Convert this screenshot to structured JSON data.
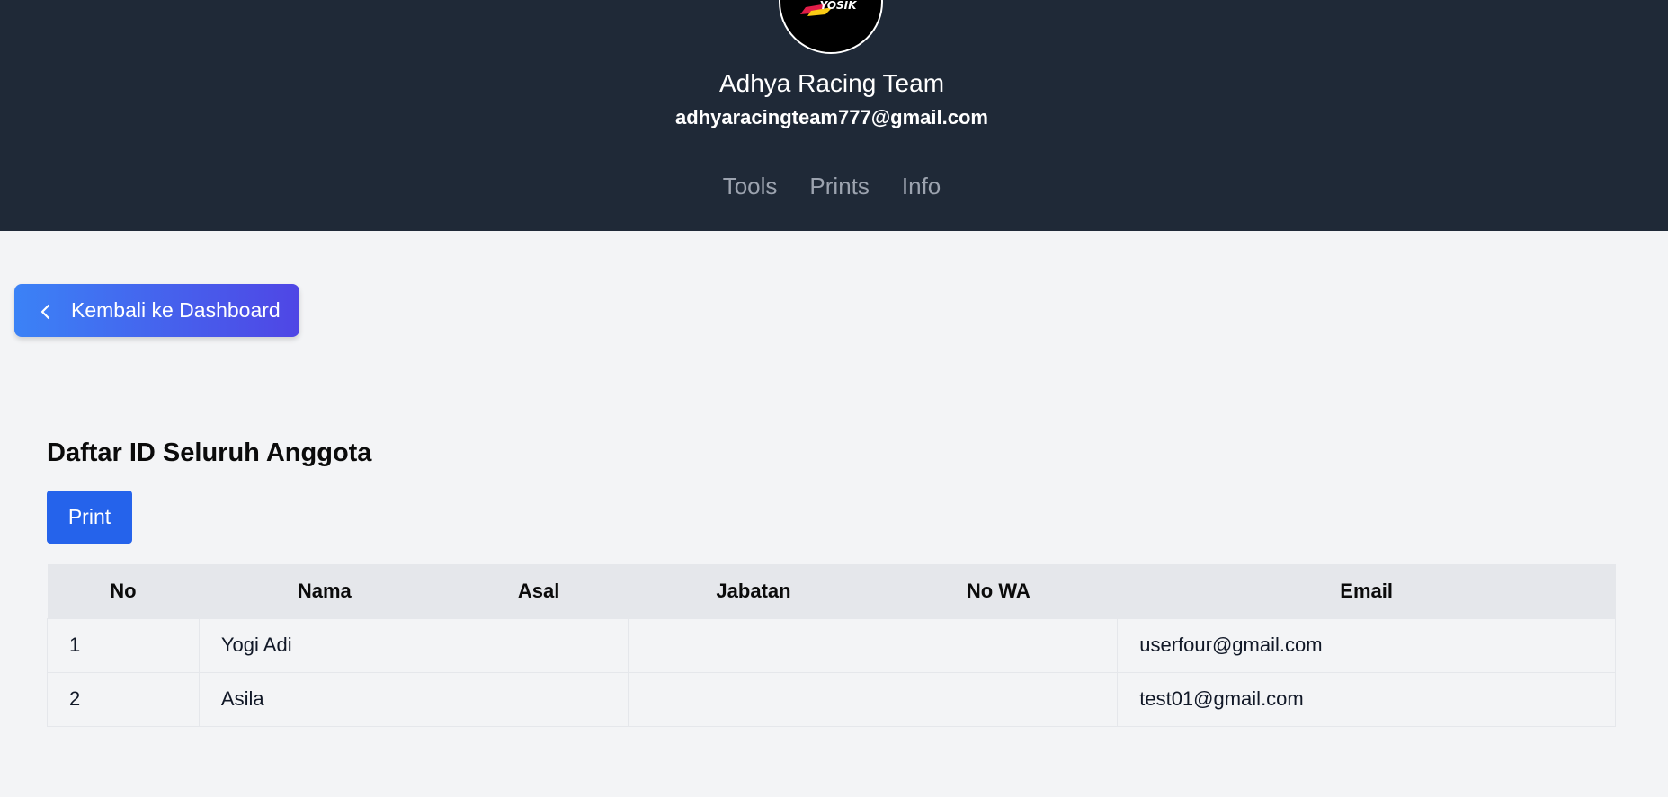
{
  "header": {
    "team_name": "Adhya Racing Team",
    "team_email": "adhyaracingteam777@gmail.com",
    "logo_text": "YOSIK",
    "nav": [
      {
        "label": "Tools"
      },
      {
        "label": "Prints"
      },
      {
        "label": "Info"
      }
    ]
  },
  "back_button": {
    "label": "Kembali ke Dashboard",
    "icon": "chevron-left-icon"
  },
  "section": {
    "title": "Daftar ID Seluruh Anggota",
    "print_label": "Print"
  },
  "table": {
    "headers": [
      "No",
      "Nama",
      "Asal",
      "Jabatan",
      "No WA",
      "Email"
    ],
    "rows": [
      [
        "1",
        "Yogi Adi",
        "",
        "",
        "",
        "userfour@gmail.com"
      ],
      [
        "2",
        "Asila",
        "",
        "",
        "",
        "test01@gmail.com"
      ]
    ]
  },
  "colors": {
    "header_bg": "#1f2937",
    "page_bg": "#f3f4f6",
    "accent": "#2563eb",
    "gradient_start": "#3b82f6",
    "gradient_end": "#4f46e5"
  }
}
